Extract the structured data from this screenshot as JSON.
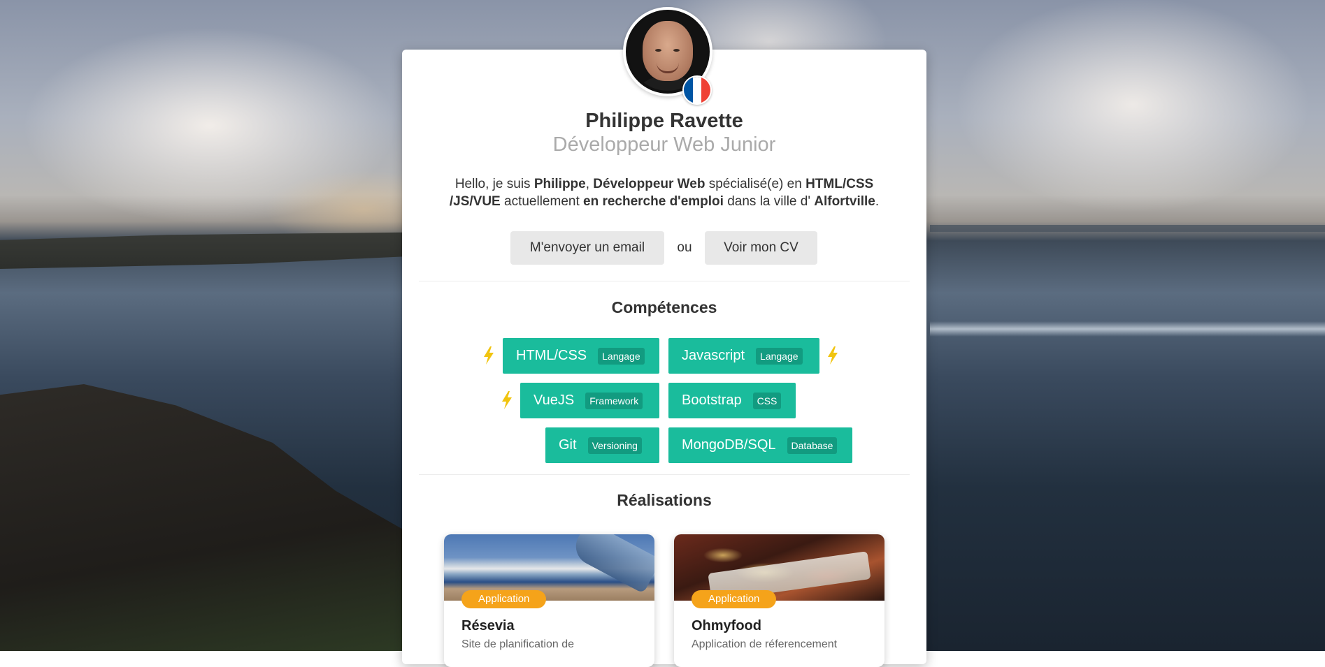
{
  "profile": {
    "name": "Philippe Ravette",
    "role": "Développeur Web Junior",
    "flag": "france-flag-icon",
    "intro": {
      "p1": "Hello, je suis ",
      "name": "Philippe",
      "p2": ", ",
      "title": "Développeur Web",
      "p3": " spécialisé(e) en ",
      "techs": "HTML/CSS /JS/VUE",
      "p4": " actuellement ",
      "search": "en recherche d'emploi",
      "p5": " dans la ville d' ",
      "city": "Alfortville",
      "p6": "."
    }
  },
  "actions": {
    "email_label": "M'envoyer un email",
    "or_label": "ou",
    "cv_label": "Voir mon CV"
  },
  "skills": {
    "title": "Compétences",
    "items": [
      {
        "name": "HTML/CSS",
        "tag": "Langage",
        "bolt": true
      },
      {
        "name": "Javascript",
        "tag": "Langage",
        "bolt": true
      },
      {
        "name": "VueJS",
        "tag": "Framework",
        "bolt": true
      },
      {
        "name": "Bootstrap",
        "tag": "CSS",
        "bolt": false
      },
      {
        "name": "Git",
        "tag": "Versioning",
        "bolt": false
      },
      {
        "name": "MongoDB/SQL",
        "tag": "Database",
        "bolt": false
      }
    ]
  },
  "projects": {
    "title": "Réalisations",
    "items": [
      {
        "badge": "Application",
        "title": "Résevia",
        "desc": "Site de planification de"
      },
      {
        "badge": "Application",
        "title": "Ohmyfood",
        "desc": "Application de réferencement"
      }
    ]
  },
  "colors": {
    "accent": "#1abc9c",
    "tag_bg": "#129b80",
    "badge": "#f5a31a",
    "bolt": "#f1c40f",
    "button_bg": "#e8e8e8"
  }
}
